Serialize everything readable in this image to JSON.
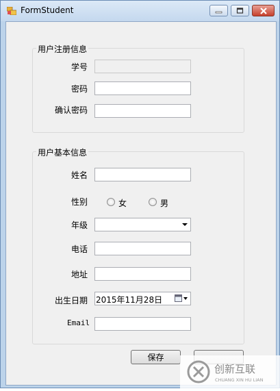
{
  "window": {
    "title": "FormStudent"
  },
  "register_group": {
    "legend": "用户注册信息",
    "student_id_label": "学号",
    "student_id_value": "",
    "password_label": "密码",
    "password_value": "",
    "confirm_password_label": "确认密码",
    "confirm_password_value": ""
  },
  "basic_group": {
    "legend": "用户基本信息",
    "name_label": "姓名",
    "name_value": "",
    "gender_label": "性别",
    "gender_female": "女",
    "gender_male": "男",
    "grade_label": "年级",
    "grade_value": "",
    "phone_label": "电话",
    "phone_value": "",
    "address_label": "地址",
    "address_value": "",
    "birthdate_label": "出生日期",
    "birthdate_value": "2015年11月28日",
    "email_label": "Email",
    "email_value": ""
  },
  "actions": {
    "save_label": "保存"
  },
  "watermark": {
    "brand": "创新互联",
    "sub": "CHUANG XIN HU LIAN"
  },
  "colors": {
    "title_bar": "#c4d8ee",
    "form_bg": "#f0f0f0",
    "close_button": "#c7402c"
  }
}
